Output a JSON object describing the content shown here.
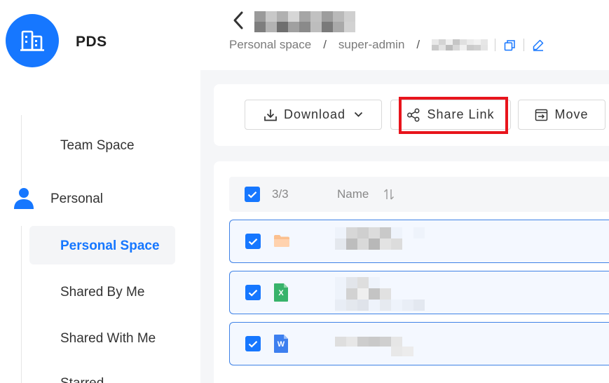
{
  "app": {
    "brand": "PDS"
  },
  "sidebar": {
    "items": [
      {
        "label": "Team Space",
        "active": false
      },
      {
        "label": "Personal",
        "active": false
      },
      {
        "label": "Personal Space",
        "active": true
      },
      {
        "label": "Shared By Me",
        "active": false
      },
      {
        "label": "Shared With Me",
        "active": false
      },
      {
        "label": "Starred",
        "active": false
      }
    ]
  },
  "header": {
    "breadcrumb": {
      "root": "Personal space",
      "separator": "/",
      "user": "super-admin"
    }
  },
  "toolbar": {
    "download_label": "Download",
    "share_link_label": "Share Link",
    "move_label": "Move",
    "highlighted": "Share Link"
  },
  "file_list": {
    "selected_count": "3/3",
    "name_column": "Name",
    "rows": [
      {
        "type": "folder",
        "icon": "folder-icon",
        "selected": true
      },
      {
        "type": "spreadsheet",
        "icon": "excel-file-icon",
        "icon_letter": "X",
        "selected": true
      },
      {
        "type": "document",
        "icon": "word-file-icon",
        "icon_letter": "W",
        "selected": true
      }
    ]
  },
  "colors": {
    "accent": "#1677ff",
    "highlight": "#e8141c",
    "row_selected_bg": "#f4f8ff",
    "row_selected_border": "#3f82e6"
  }
}
